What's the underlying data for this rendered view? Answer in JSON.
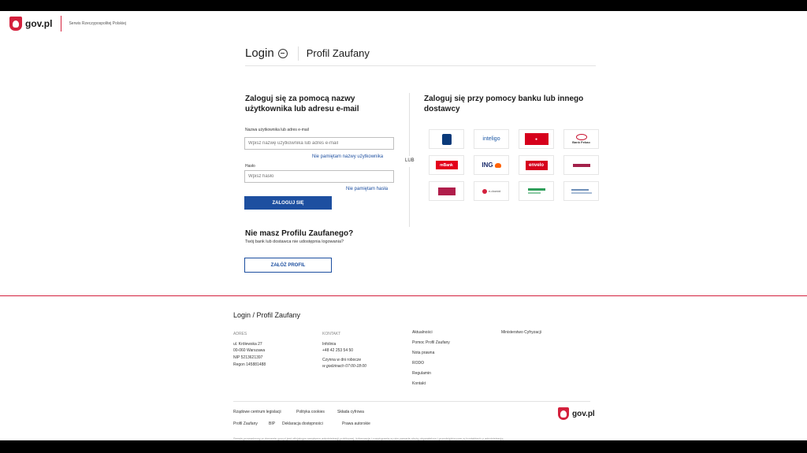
{
  "header": {
    "brand": "gov.pl",
    "service": "Serwis Rzeczypospolitej Polskiej"
  },
  "title_row": {
    "login": "Login",
    "profil": "Profil Zaufany"
  },
  "login_form": {
    "heading": "Zaloguj się za pomocą nazwy użytkownika lub adresu e-mail",
    "username_label": "Nazwa użytkownika lub adres e-mail",
    "username_placeholder": "Wpisz nazwę użytkownika lub adres e-mail",
    "forgot_username": "Nie pamiętam nazwy użytkownika",
    "password_label": "Hasło",
    "password_placeholder": "Wpisz hasło",
    "forgot_password": "Nie pamiętam hasła",
    "submit": "ZALOGUJ SIĘ"
  },
  "no_profile": {
    "heading": "Nie masz Profilu Zaufanego?",
    "subtext": "Twój bank lub dostawca nie udostępnia logowania?",
    "create_button": "ZAŁÓŻ PROFIL"
  },
  "divider_label": "LUB",
  "bank_section": {
    "heading": "Zaloguj się przy pomocy banku lub innego dostawcy",
    "banks": [
      {
        "name": "PKO",
        "text": "",
        "color": "#0a3a7a",
        "icon": "pko-logo-icon"
      },
      {
        "name": "inteligo",
        "text": "inteligo",
        "color": "#1f5aa6",
        "icon": "inteligo-logo-icon"
      },
      {
        "name": "Santander",
        "text": "",
        "color": "#d6001c",
        "icon": "santander-logo-icon"
      },
      {
        "name": "Bank Pekao",
        "text": "Bank Pekao",
        "color": "#c8102e",
        "icon": "pekao-logo-icon"
      },
      {
        "name": "mBank",
        "text": "mBank",
        "color": "#e3001b",
        "icon": "mbank-logo-icon"
      },
      {
        "name": "ING",
        "text": "ING",
        "color": "#1a2b6b",
        "icon": "ing-logo-icon"
      },
      {
        "name": "envelo",
        "text": "envelo",
        "color": "#d6001c",
        "icon": "envelo-logo-icon"
      },
      {
        "name": "Credit Agricole",
        "text": "",
        "color": "#a3214a",
        "icon": "credit-agricole-logo-icon"
      },
      {
        "name": "Millennium",
        "text": "",
        "color": "#b01e4b",
        "icon": "millennium-logo-icon"
      },
      {
        "name": "e-dowód",
        "text": "e-dowód",
        "color": "#d4213d",
        "icon": "e-dowod-logo-icon"
      },
      {
        "name": "BOŚ",
        "text": "",
        "color": "#2e9e5a",
        "icon": "bos-logo-icon"
      },
      {
        "name": "Inny dostawca",
        "text": "",
        "color": "#6e8fb8",
        "icon": "other-provider-logo-icon"
      }
    ]
  },
  "footer": {
    "title": "Login / Profil Zaufany",
    "address_header": "ADRES",
    "address_lines": [
      "ul. Królewska 27",
      "00-060 Warszawa",
      "NIP 5213621397",
      "Regon 145881488"
    ],
    "contact_header": "KONTAKT",
    "contact_lines": [
      "Infolinia",
      "+48 42 253 54 50",
      "Czynna w dni robocze",
      "w godzinach 07:00-18:00"
    ],
    "links_col1": [
      "Aktualności",
      "Pomoc Profil Zaufany",
      "Nota prawna",
      "RODO",
      "Regulamin",
      "Kontakt"
    ],
    "links_col2": [
      "Ministerstwo Cyfryzacji"
    ],
    "bottom_row1": [
      "Rządowe centrum legislacji",
      "Polityka cookies",
      "Składa cyfrowa"
    ],
    "bottom_row2": [
      "Profil Zaufany",
      "BIP",
      "Deklaracja dostępności",
      "Prawa autorskie"
    ],
    "fine_print": "Serwis prowadzony w domenie gov.pl jest oficjalnym serwisem administracji publicznej. Informacje i rozwiązania w nim zawarte służą obywatelom i przedsiębiorcom w kontaktach z administracją.",
    "brand": "gov.pl"
  },
  "colors": {
    "gov_red": "#d4213d",
    "primary_blue": "#1d4fa0"
  }
}
